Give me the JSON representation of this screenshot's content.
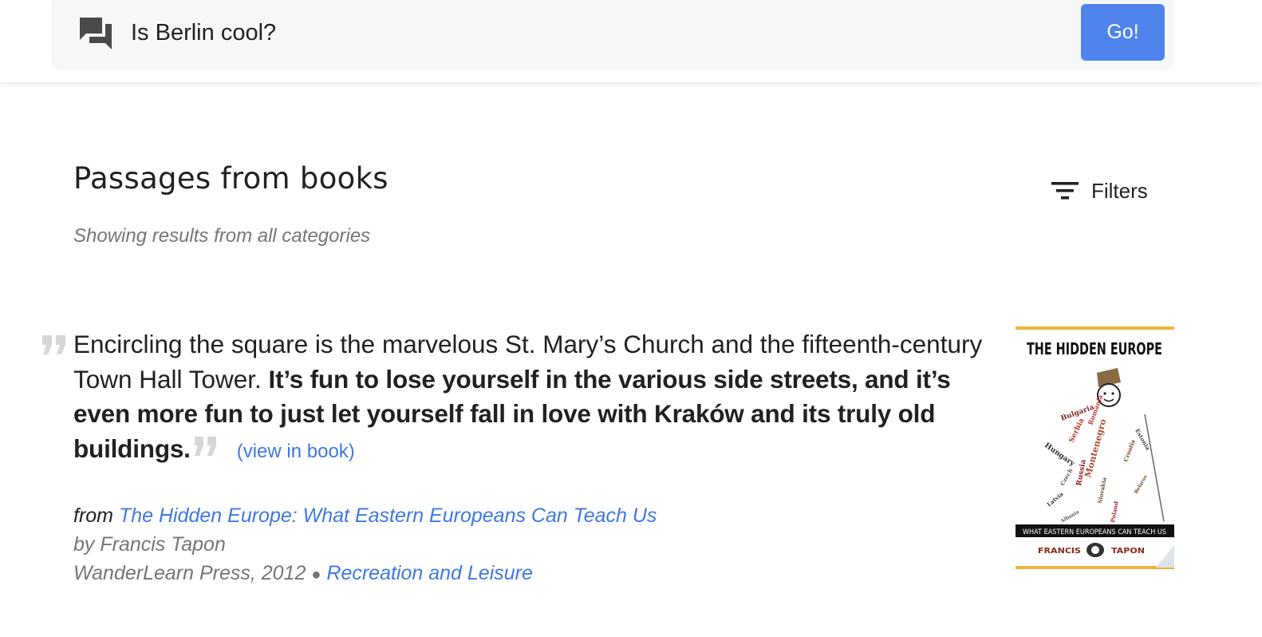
{
  "search": {
    "query": "Is Berlin cool?",
    "go_label": "Go!"
  },
  "section": {
    "title": "Passages from books",
    "subtitle": "Showing results from all categories",
    "filters_label": "Filters"
  },
  "result": {
    "passage_plain": "Encircling the square is the marvelous St. Mary’s Church and the fifteenth-century Town Hall Tower. ",
    "passage_bold": "It’s fun to lose yourself in the various side streets, and it’s even more fun to just let yourself fall in love with Kraków and its truly old buildings.",
    "view_link": "(view in book)",
    "from_word": "from",
    "book_title": "The Hidden Europe: What Eastern Europeans Can Teach Us",
    "author_line": "by Francis Tapon",
    "publisher_year": "WanderLearn Press, 2012",
    "separator": "●",
    "category": "Recreation and Leisure"
  },
  "cover": {
    "title": "THE HIDDEN EUROPE",
    "tagline": "WHAT EASTERN EUROPEANS CAN TEACH US",
    "author_first": "FRANCIS",
    "author_last": "TAPON",
    "words": [
      "Bulgaria",
      "Romania",
      "Hungary",
      "Serbia",
      "Montenegro",
      "Russia",
      "Czech",
      "Slovakia",
      "Croatia",
      "Estonia",
      "Latvia",
      "Poland",
      "Albania",
      "Belarus"
    ]
  },
  "colors": {
    "accent": "#4f84ec",
    "link": "#3f78e0",
    "muted": "#757575",
    "cover_border": "#f0b33a"
  }
}
